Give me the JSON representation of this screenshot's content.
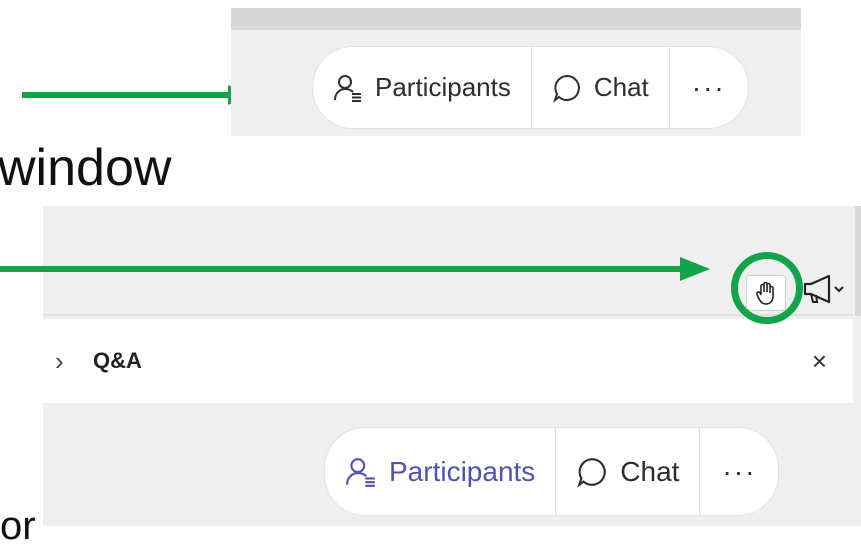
{
  "toolbar_top": {
    "participants_label": "Participants",
    "chat_label": "Chat",
    "more_label": "···",
    "icons": {
      "participants": "participants-icon",
      "chat": "chat-bubble-icon"
    }
  },
  "caption": {
    "window_text": "window",
    "bottom_text": "or"
  },
  "qa_window": {
    "section_title": "Q&A",
    "expand_glyph": "›",
    "close_glyph": "×",
    "icons": {
      "raise_hand": "raise-hand-icon",
      "announce": "megaphone-icon"
    }
  },
  "toolbar_bottom": {
    "participants_label": "Participants",
    "chat_label": "Chat",
    "more_label": "···"
  },
  "colors": {
    "annotation_green": "#11a44a",
    "active_blue": "#4f52b2",
    "panel_gray": "#efefef"
  }
}
